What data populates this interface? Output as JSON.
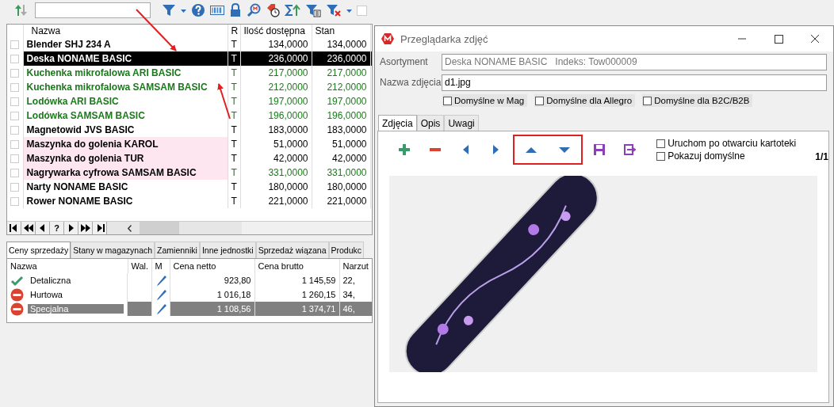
{
  "toolbar": {
    "option": {
      "checked": false
    }
  },
  "products": {
    "columns": [
      "Nazwa",
      "R",
      "Ilość dostępna",
      "Stan"
    ],
    "rows": [
      {
        "name": "Blender SHJ 234 A",
        "r": "T",
        "available": "134,0000",
        "stock": "134,0000",
        "kind": "normal",
        "selected": false,
        "checked": false
      },
      {
        "name": "Deska NONAME BASIC",
        "r": "T",
        "available": "236,0000",
        "stock": "236,0000",
        "kind": "normal",
        "selected": true,
        "checked": false
      },
      {
        "name": "Kuchenka mikrofalowa ARI BASIC",
        "r": "T",
        "available": "217,0000",
        "stock": "217,0000",
        "kind": "green",
        "selected": false,
        "checked": false
      },
      {
        "name": "Kuchenka mikrofalowa SAMSAM BASIC",
        "r": "T",
        "available": "212,0000",
        "stock": "212,0000",
        "kind": "green",
        "selected": false,
        "checked": false
      },
      {
        "name": "Lodówka ARI BASIC",
        "r": "T",
        "available": "197,0000",
        "stock": "197,0000",
        "kind": "green",
        "selected": false,
        "checked": false
      },
      {
        "name": "Lodówka SAMSAM BASIC",
        "r": "T",
        "available": "196,0000",
        "stock": "196,0000",
        "kind": "green",
        "selected": false,
        "checked": false
      },
      {
        "name": "Magnetowid JVS BASIC",
        "r": "T",
        "available": "183,0000",
        "stock": "183,0000",
        "kind": "normal",
        "selected": false,
        "checked": false
      },
      {
        "name": "Maszynka do golenia KAROL",
        "r": "T",
        "available": "51,0000",
        "stock": "51,0000",
        "kind": "pink",
        "selected": false,
        "checked": false
      },
      {
        "name": "Maszynka do golenia TUR",
        "r": "T",
        "available": "42,0000",
        "stock": "42,0000",
        "kind": "pink",
        "selected": false,
        "checked": false
      },
      {
        "name": "Nagrywarka cyfrowa SAMSAM BASIC",
        "r": "T",
        "available": "331,0000",
        "stock": "331,0000",
        "kind": "pink-green",
        "selected": false,
        "checked": false
      },
      {
        "name": "Narty NONAME BASIC",
        "r": "T",
        "available": "180,0000",
        "stock": "180,0000",
        "kind": "normal",
        "selected": false,
        "checked": false
      },
      {
        "name": "Rower NONAME BASIC",
        "r": "T",
        "available": "221,0000",
        "stock": "221,0000",
        "kind": "normal",
        "selected": false,
        "checked": false
      }
    ],
    "navigator": [
      "?"
    ]
  },
  "detail_tabs": [
    {
      "label": "Ceny sprzedaży",
      "selected": true
    },
    {
      "label": "Stany w magazynach",
      "selected": false
    },
    {
      "label": "Zamienniki",
      "selected": false
    },
    {
      "label": "Inne jednostki",
      "selected": false
    },
    {
      "label": "Sprzedaż wiązana",
      "selected": false
    },
    {
      "label": "Produkc",
      "selected": false
    }
  ],
  "prices": {
    "columns": [
      "Nazwa",
      "Wal.",
      "M",
      "Cena netto",
      "Cena brutto",
      "Narzut"
    ],
    "rows": [
      {
        "kind": "check",
        "name": "Detaliczna",
        "net": "923,80",
        "gross": "1 145,59",
        "markup": "22,",
        "selected": false
      },
      {
        "kind": "blocked",
        "name": "Hurtowa",
        "net": "1 016,18",
        "gross": "1 260,15",
        "markup": "34,",
        "selected": false
      },
      {
        "kind": "blocked",
        "name": "Specjalna",
        "net": "1 108,56",
        "gross": "1 374,71",
        "markup": "46,",
        "selected": true
      }
    ]
  },
  "photo_viewer": {
    "title": "Przeglądarka zdjęć",
    "fields": [
      {
        "label": "Asortyment",
        "value": "Deska NONAME BASIC   Indeks: Tow000009",
        "disabled": true
      },
      {
        "label": "Nazwa zdjęcia",
        "value": "d1.jpg",
        "disabled": false
      }
    ],
    "defaults": [
      {
        "label": "Domyślne w Mag",
        "checked": false
      },
      {
        "label": "Domyślne dla Allegro",
        "checked": false
      },
      {
        "label": "Domyślne dla B2C/B2B",
        "checked": false
      }
    ],
    "tabs": [
      {
        "label": "Zdjęcia",
        "selected": true
      },
      {
        "label": "Opis",
        "selected": false
      },
      {
        "label": "Uwagi",
        "selected": false
      }
    ],
    "options": [
      {
        "label": "Uruchom po otwarciu kartoteki",
        "checked": false
      },
      {
        "label": "Pokazuj domyślne",
        "checked": false
      }
    ],
    "counter": "1/1"
  }
}
